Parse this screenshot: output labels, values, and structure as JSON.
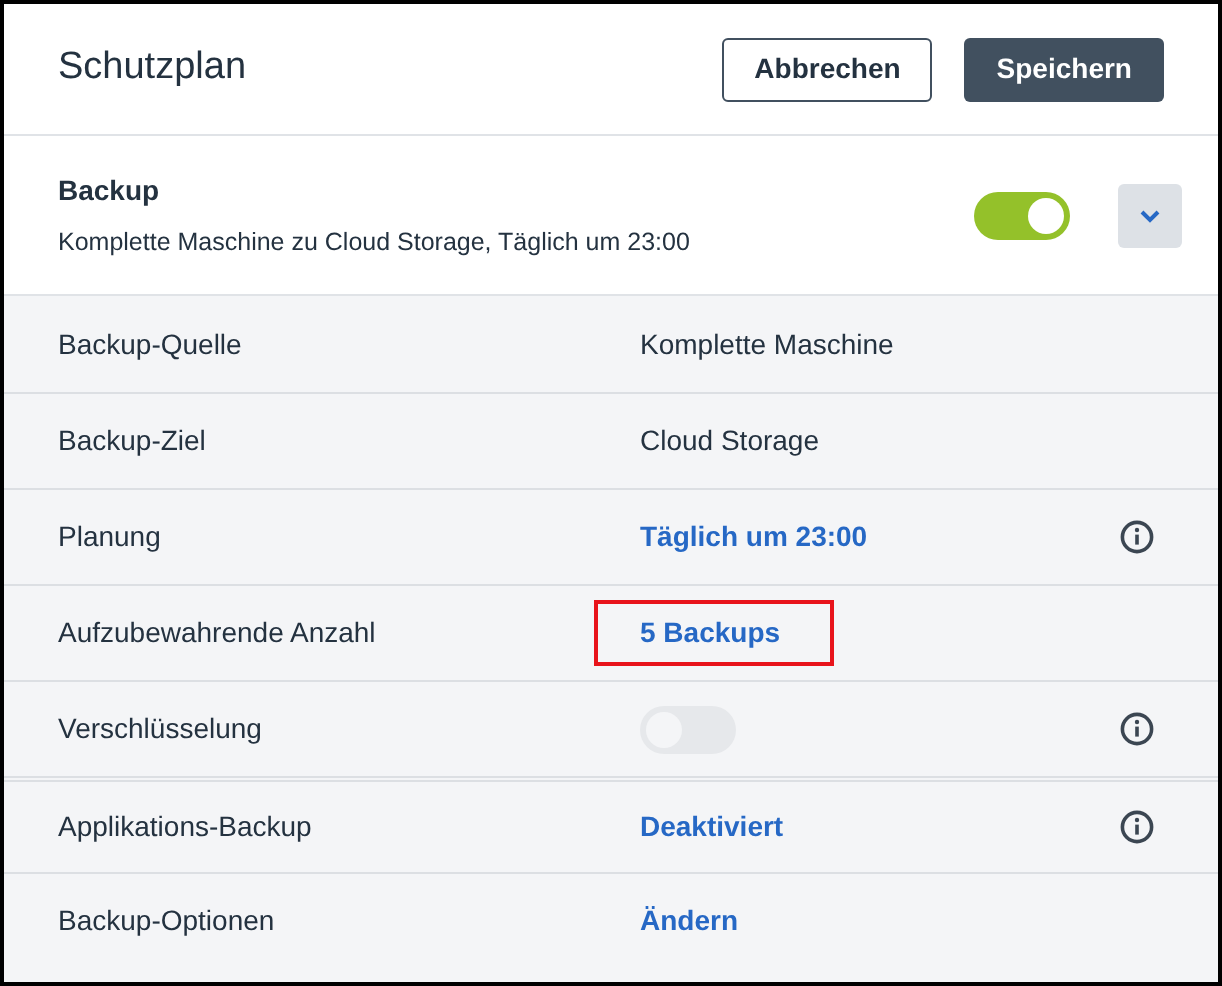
{
  "title": "Schutzplan",
  "buttons": [
    {
      "label": "Abbrechen",
      "kind": "secondary"
    },
    {
      "label": "Speichern",
      "kind": "primary"
    }
  ],
  "section": {
    "title": "Backup",
    "summary": "Komplette Maschine zu Cloud Storage, Täglich um 23:00",
    "on": true,
    "expanded": false
  },
  "rows": [
    {
      "label": "Backup-Quelle",
      "kind": "text",
      "value": "Komplette Maschine",
      "info": false,
      "highlighted": false
    },
    {
      "label": "Backup-Ziel",
      "kind": "text",
      "value": "Cloud Storage",
      "info": false,
      "highlighted": false
    },
    {
      "label": "Planung",
      "kind": "link",
      "value": "Täglich um 23:00",
      "info": true,
      "highlighted": false
    },
    {
      "label": "Aufzubewahrende Anzahl",
      "kind": "link",
      "value": "5 Backups",
      "info": false,
      "highlighted": true
    },
    {
      "label": "Verschlüsselung",
      "kind": "toggle",
      "on": false,
      "info": true,
      "highlighted": false
    },
    {
      "label": "Applikations-Backup",
      "kind": "link",
      "value": "Deaktiviert",
      "info": true,
      "highlighted": false,
      "separated": true
    },
    {
      "label": "Backup-Optionen",
      "kind": "link",
      "value": "Ändern",
      "info": false,
      "highlighted": false
    }
  ]
}
